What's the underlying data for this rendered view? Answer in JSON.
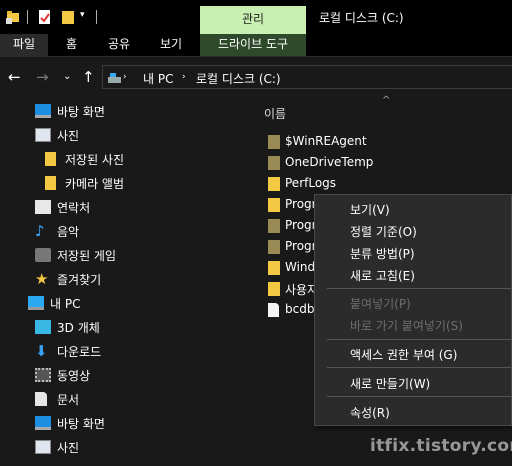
{
  "titlebar": {
    "manage_tab": "관리",
    "window_title": "로컬 디스크 (C:)"
  },
  "ribbon": {
    "tabs": [
      "파일",
      "홈",
      "공유",
      "보기"
    ],
    "contextual_tab": "드라이브 도구"
  },
  "address": {
    "segments": [
      "내 PC",
      "로컬 디스크 (C:)"
    ]
  },
  "nav_pane": {
    "items": [
      {
        "label": "바탕 화면",
        "icon": "desktop-icon"
      },
      {
        "label": "사진",
        "icon": "pictures-icon"
      },
      {
        "label": "저장된 사진",
        "icon": "folder-icon"
      },
      {
        "label": "카메라 앨범",
        "icon": "folder-icon"
      },
      {
        "label": "연락처",
        "icon": "contacts-icon"
      },
      {
        "label": "음악",
        "icon": "music-icon"
      },
      {
        "label": "저장된 게임",
        "icon": "saved-games-icon"
      },
      {
        "label": "즐겨찾기",
        "icon": "star-icon"
      },
      {
        "label": "내 PC",
        "icon": "pc-icon"
      },
      {
        "label": "3D 개체",
        "icon": "3d-objects-icon"
      },
      {
        "label": "다운로드",
        "icon": "download-icon"
      },
      {
        "label": "동영상",
        "icon": "video-icon"
      },
      {
        "label": "문서",
        "icon": "document-icon"
      },
      {
        "label": "바탕 화면",
        "icon": "desktop-icon"
      },
      {
        "label": "사진",
        "icon": "pictures-icon"
      }
    ]
  },
  "file_pane": {
    "column_header": "이름",
    "files": [
      {
        "name": "$WinREAgent",
        "icon": "folder-icon"
      },
      {
        "name": "OneDriveTemp",
        "icon": "folder-icon"
      },
      {
        "name": "PerfLogs",
        "icon": "folder-icon"
      },
      {
        "name": "Progra",
        "icon": "folder-icon"
      },
      {
        "name": "Progra",
        "icon": "folder-icon"
      },
      {
        "name": "Progra",
        "icon": "folder-icon"
      },
      {
        "name": "Windo",
        "icon": "folder-icon"
      },
      {
        "name": "사용자",
        "icon": "folder-icon"
      },
      {
        "name": "bcdba",
        "icon": "file-icon"
      }
    ]
  },
  "context_menu": {
    "view": "보기(V)",
    "sort_by": "정렬 기준(O)",
    "group_by": "분류 방법(P)",
    "refresh": "새로 고침(E)",
    "paste": "붙여넣기(P)",
    "paste_shortcut": "바로 가기 붙여넣기(S)",
    "give_access": "액세스 권한 부여 (G)",
    "new": "새로 만들기(W)",
    "properties": "속성(R)"
  },
  "watermark": "itfix.tistory.com"
}
